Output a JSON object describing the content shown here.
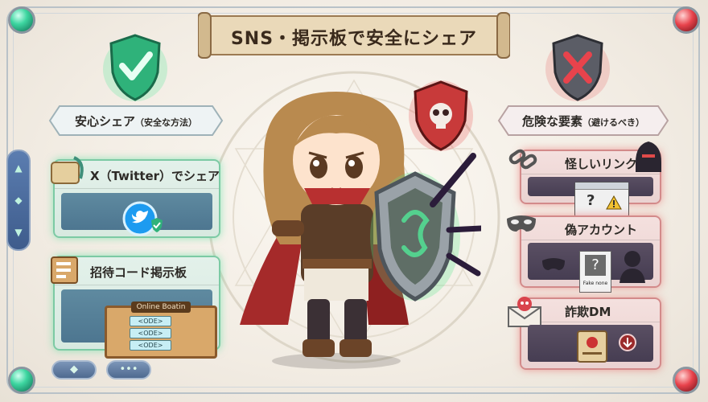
{
  "title": "SNS・掲示板で安全にシェア",
  "safe": {
    "heading": "安心シェア",
    "heading_sub": "（安全な方法）",
    "cards": [
      {
        "label": "X（Twitter）でシェア",
        "icon": "twitter-bird-icon"
      },
      {
        "label": "招待コード掲示板",
        "icon": "bulletin-board-icon",
        "board_title": "Online Boatin",
        "codes": [
          "<ODE>",
          "<ODE>",
          "<ODE>"
        ]
      }
    ]
  },
  "danger": {
    "heading": "危険な要素",
    "heading_sub": "（避けるべき）",
    "cards": [
      {
        "label": "怪しいリンク",
        "icon": "broken-link-icon",
        "browser_glyph": "?"
      },
      {
        "label": "偽アカウント",
        "icon": "mask-icon",
        "card_glyph": "?",
        "caption": "Fake none"
      },
      {
        "label": "詐欺DM",
        "icon": "skull-envelope-icon"
      }
    ]
  },
  "colors": {
    "safe": "#3fcf8e",
    "danger": "#d9434c",
    "banner": "#e9d8b8"
  },
  "nav": {
    "up": "▲",
    "middle": "◆",
    "down": "▼",
    "pill_left": "◆",
    "pill_right": "•••"
  }
}
